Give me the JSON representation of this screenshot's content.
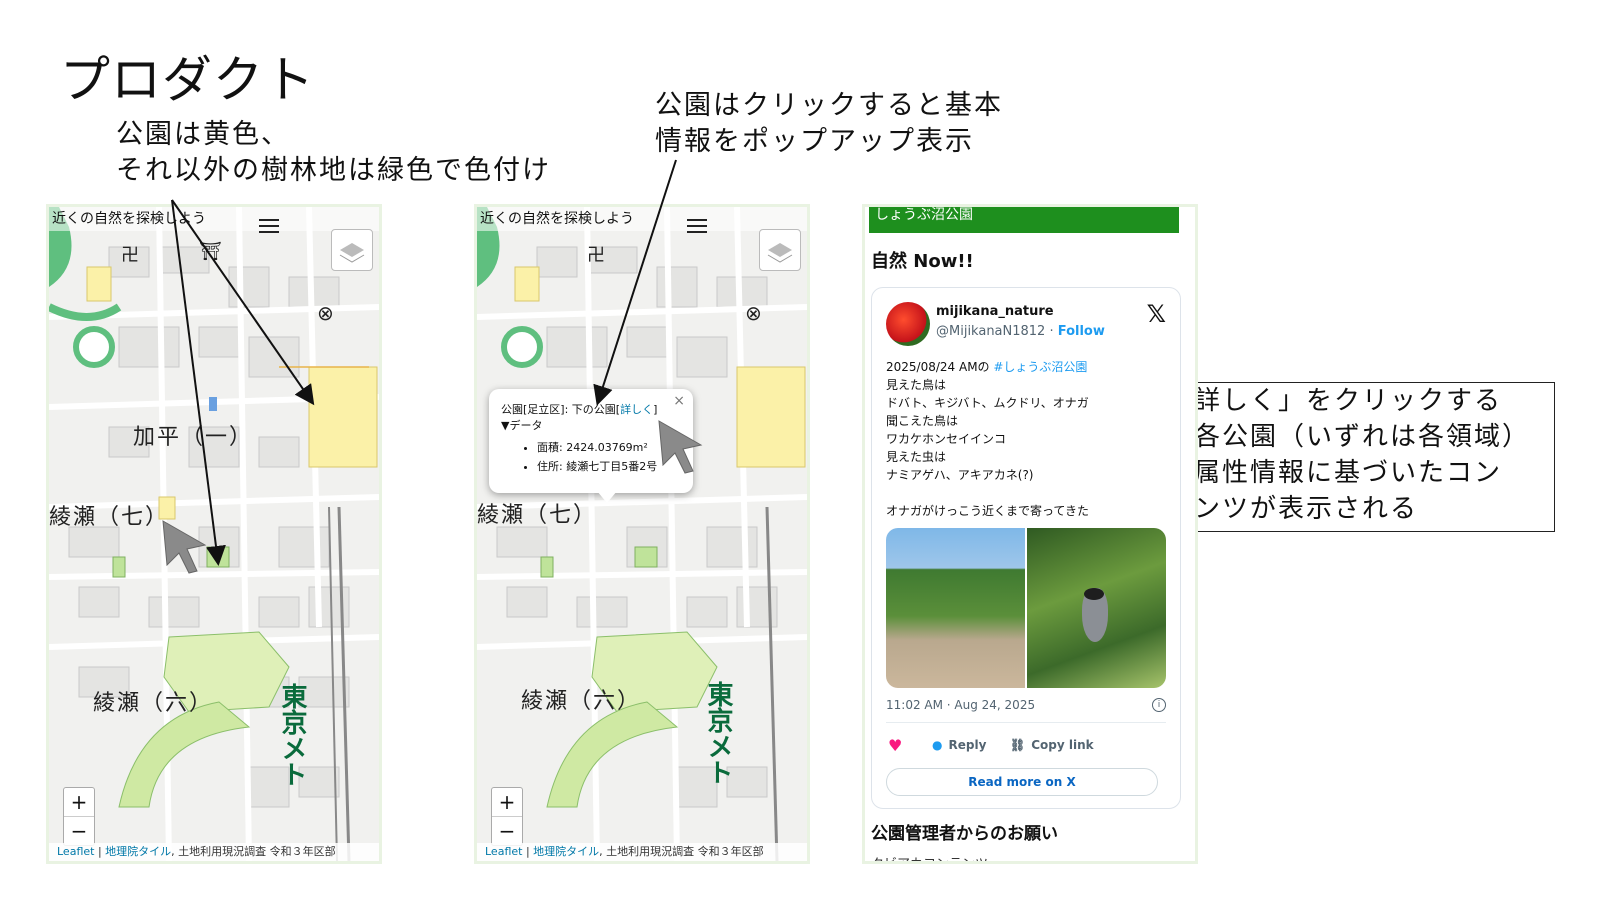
{
  "slide": {
    "title": "プロダクト",
    "note_color_line1": "公園は黄色、",
    "note_color_line2": "それ以外の樹林地は緑色で色付け",
    "note_popup_line1": "公園はクリックすると基本",
    "note_popup_line2": "情報をポップアップ表示",
    "note_detail_line1": "「詳しく」をクリックする",
    "note_detail_line2": "と各公園（いずれは各領域）",
    "note_detail_line3": "の属性情報に基づいたコン",
    "note_detail_line4": "テンツが表示される"
  },
  "map": {
    "header": "近くの自然を探検しよう",
    "zoom_in": "+",
    "zoom_out": "−",
    "attribution_leaflet": "Leaflet",
    "attribution_sep": " | ",
    "attribution_tiles": "地理院タイル",
    "attribution_rest": ", 土地利用現況調査 令和３年区部",
    "places": {
      "kahei": "加平（一）",
      "ayase7": "綾瀬（七）",
      "ayase6": "綾瀬（六）",
      "metro": "東京メト"
    },
    "map_symbols": {
      "temple": "卍",
      "shrine": "⛩",
      "police": "⊗",
      "school": "文",
      "post": "〒"
    }
  },
  "popup": {
    "title_prefix": "公園[足立区]: 下の公園[",
    "detail_link": "詳しく",
    "title_suffix": "]",
    "close": "×",
    "data_toggle": "▼データ",
    "area": "面積: 2424.03769m²",
    "address": "住所: 綾瀬七丁目5番2号"
  },
  "web": {
    "park_bar": "しょうぶ沼公園",
    "nature_heading": "自然 Now!!",
    "tweet": {
      "username": "mijikana_nature",
      "handle": "@MijikanaN1812 · ",
      "follow": "Follow",
      "x_logo": "𝕏",
      "line1_prefix": "2025/08/24 AMの ",
      "hashtag": "#しょうぶ沼公園",
      "body": "見えた鳥は\nドバト、キジバト、ムクドリ、オナガ\n聞こえた鳥は\nワカケホンセイインコ\n見えた虫は\nナミアゲハ、アキアカネ(?)\n\nオナガがけっこう近くまで寄ってきた",
      "time": "11:02 AM · Aug 24, 2025",
      "info": "i",
      "heart": "♥",
      "reply": "Reply",
      "copy_link": "Copy link",
      "read_more": "Read more on X"
    },
    "admin_heading": "公園管理者からのお願い",
    "admin_sub": "クビアカコンテンツ"
  },
  "colors": {
    "park_yellow": "#fbf1a8",
    "forest_green": "#bfe39a",
    "road_green": "#5fbf7f",
    "bar_green": "#1e8f1e",
    "link_blue": "#1d9bf0"
  }
}
